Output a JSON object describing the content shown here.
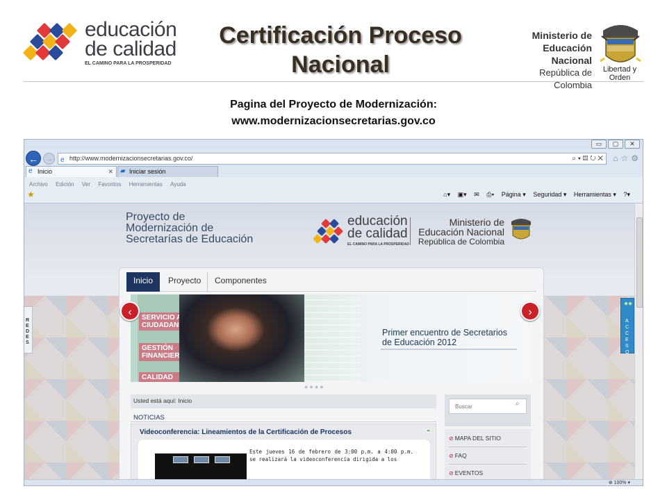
{
  "slide": {
    "title": "Certificación Proceso Nacional",
    "subtitle_line1": "Pagina del Proyecto de Modernización:",
    "subtitle_line2": "www.modernizacionsecretarias.gov.co"
  },
  "logo_left": {
    "line1": "educación",
    "line2": "de calidad",
    "tagline": "EL CAMINO PARA LA PROSPERIDAD"
  },
  "ministry": {
    "line1": "Ministerio de",
    "line2": "Educación Nacional",
    "line3": "República de Colombia",
    "motto": "Libertad y Orden"
  },
  "browser": {
    "url": "http://www.modernizacionsecretarias.gov.co/",
    "url_tools": "⌕ ▾ ▤ ↻ ✕",
    "home_icons": "⌂☆⚙",
    "window_buttons": [
      "▭",
      "▢",
      "✕"
    ],
    "tabs": [
      {
        "label": "Inicio",
        "close": "✕"
      },
      {
        "label": "Iniciar sesión"
      }
    ],
    "menu": [
      "Archivo",
      "Edición",
      "Ver",
      "Favoritos",
      "Herramientas",
      "Ayuda"
    ],
    "command_bar": [
      "Página ▾",
      "Seguridad ▾",
      "Herramientas ▾"
    ],
    "zoom": "100%"
  },
  "site": {
    "project_title_l1": "Proyecto de",
    "project_title_l2": "Modernización de",
    "project_title_l3": "Secretarías de Educación",
    "nav_tabs": [
      "Inicio",
      "Proyecto",
      "Componentes"
    ],
    "carousel": {
      "labels": [
        "SERVICIO AL CIUDADANO",
        "GESTIÓN FINANCIERA",
        "CALIDAD"
      ],
      "caption_l1": "Primer encuentro de Secretarios",
      "caption_l2": "de Educación 2012",
      "dots": "●●●●"
    },
    "redes": "REDES",
    "acceso": "ACCESO",
    "breadcrumb": "Usted está aquí: Inicio",
    "section": "NOTICIAS",
    "news": {
      "title": "Videoconferencia: Lineamientos de la Certificación de Procesos",
      "minimize": "-",
      "text": "Este jueves 16 de febrero de 3:00 p.m. a 4:00 p.m. se realizará la videoconferencia dirigida a los"
    },
    "search_placeholder": "Buscar",
    "side_links": [
      "MAPA DEL SITIO",
      "FAQ",
      "EVENTOS"
    ]
  },
  "colors": {
    "title": "#3a2e21",
    "nav_active": "#1d3560",
    "carousel_arrow": "#c9202a",
    "acceso": "#2f8ac8"
  }
}
